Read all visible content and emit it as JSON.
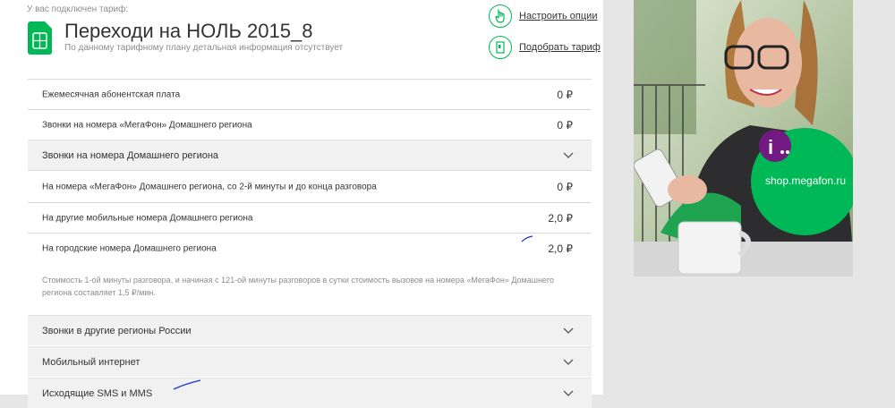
{
  "tariff": {
    "connected_label": "У вас подключен тариф:",
    "name": "Переходи на НОЛЬ 2015_8",
    "description": "По данному тарифному плану детальная информация отсутствует"
  },
  "options": {
    "configure_label": "Настроить опции",
    "pick_tariff_label": "Подобрать тариф"
  },
  "rows": [
    {
      "label": "Ежемесячная абонентская плата",
      "value": "0 ₽"
    },
    {
      "label": "Звонки на номера «МегаФон» Домашнего региона",
      "value": "0 ₽"
    }
  ],
  "sections": {
    "home_calls": {
      "title": "Звонки на номера Домашнего региона",
      "rows": [
        {
          "label": "На номера «МегаФон» Домашнего региона, со 2-й минуты и до конца разговора",
          "value": "0 ₽"
        },
        {
          "label": "На другие мобильные номера Домашнего региона",
          "value": "2,0 ₽"
        },
        {
          "label": "На городские номера Домашнего региона",
          "value": "2,0 ₽"
        }
      ],
      "note": "Стоимость 1-ой минуты разговора, и начиная с 121-ой минуты разговоров в сутки стоимость вызовов на номера «МегаФон» Домашнего региона составляет 1,5 ₽/мин."
    },
    "other_regions": {
      "title": "Звонки в другие регионы России"
    },
    "mobile_internet": {
      "title": "Мобильный интернет"
    },
    "sms_mms": {
      "title": "Исходящие SMS и MMS"
    }
  },
  "ad": {
    "text": "shop.megafon.ru"
  },
  "colors": {
    "accent": "#00b956",
    "purple": "#731982",
    "row_grey": "#f1f1f1"
  }
}
